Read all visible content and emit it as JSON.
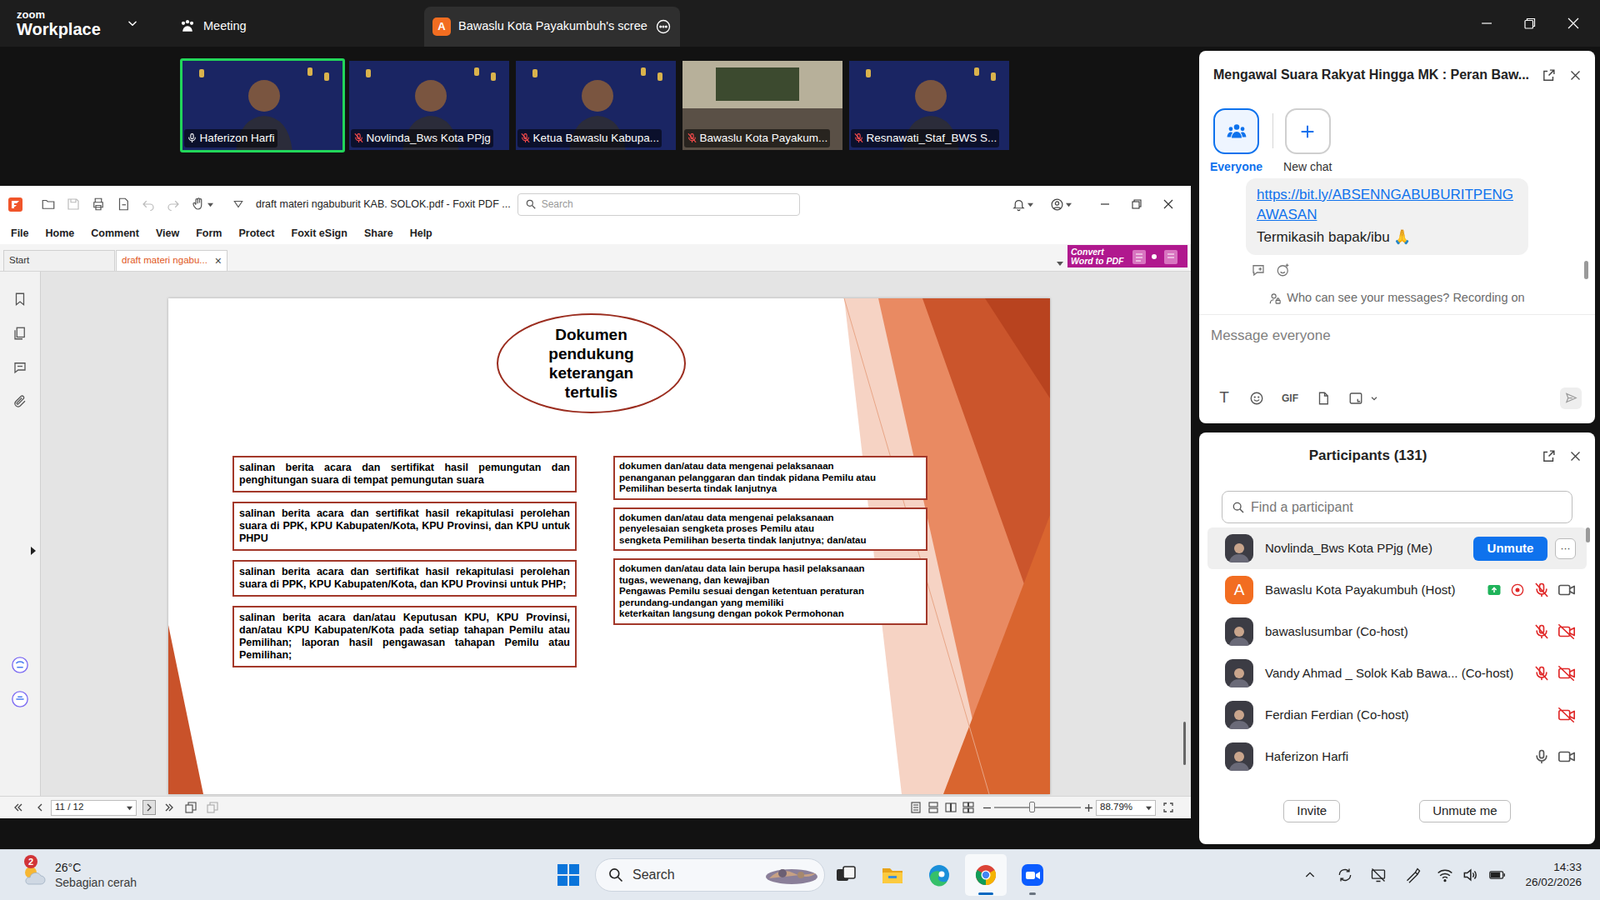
{
  "app": {
    "logo_top": "zoom",
    "logo_bottom": "Workplace"
  },
  "tabs": [
    {
      "label": "Meeting",
      "selected": false
    },
    {
      "label": "Bawaslu Kota Payakumbuh's scree",
      "avatar": "A",
      "selected": true
    }
  ],
  "videos": [
    {
      "name": "Haferizon Harfi",
      "muted": false,
      "speaking": true,
      "kind": "person"
    },
    {
      "name": "Novlinda_Bws Kota PPjg",
      "muted": true,
      "speaking": false,
      "kind": "person"
    },
    {
      "name": "Ketua Bawaslu Kabupa...",
      "muted": true,
      "speaking": false,
      "kind": "person"
    },
    {
      "name": "Bawaslu Kota Payakum...",
      "muted": true,
      "speaking": false,
      "kind": "room"
    },
    {
      "name": "Resnawati_Staf_BWS S...",
      "muted": true,
      "speaking": false,
      "kind": "person"
    }
  ],
  "pdf": {
    "title": "draft materi ngabuburit KAB. SOLOK.pdf - Foxit PDF ...",
    "search": {
      "placeholder": "Search"
    },
    "menu": [
      "File",
      "Home",
      "Comment",
      "View",
      "Form",
      "Protect",
      "Foxit eSign",
      "Share",
      "Help"
    ],
    "promo": {
      "line1": "Convert",
      "line2": "Word to PDF"
    },
    "doc_tabs": [
      {
        "label": "Start",
        "selected": false
      },
      {
        "label": "draft materi ngabu...",
        "selected": true,
        "close": "×"
      }
    ],
    "slide": {
      "title": "Dokumen pendukung keterangan tertulis",
      "left": [
        "salinan berita acara dan sertifikat hasil pemungutan dan penghitungan suara di tempat pemungutan suara",
        "salinan berita acara dan sertifikat hasil rekapitulasi perolehan suara di PPK, KPU Kabupaten/Kota, KPU Provinsi, dan KPU untuk PHPU",
        "salinan berita acara dan sertifikat hasil rekapitulasi perolehan suara di PPK, KPU Kabupaten/Kota, dan KPU Provinsi untuk PHP;",
        "salinan berita acara dan/atau Keputusan KPU, KPU Provinsi, dan/atau KPU Kabupaten/Kota pada setiap tahapan Pemilu atau Pemilihan; laporan hasil pengawasan tahapan Pemilu atau Pemilihan;"
      ],
      "right": [
        "dokumen dan/atau data mengenai pelaksanaan\npenanganan pelanggaran dan tindak pidana Pemilu atau\nPemilihan beserta tindak lanjutnya",
        "dokumen dan/atau data mengenai pelaksanaan\npenyelesaian sengketa proses Pemilu atau\nsengketa Pemilihan beserta tindak lanjutnya; dan/atau",
        "dokumen dan/atau data lain berupa hasil pelaksanaan\ntugas, wewenang, dan kewajiban\nPengawas Pemilu sesuai dengan ketentuan peraturan\nperundang-undangan yang memiliki\nketerkaitan langsung dengan pokok Permohonan"
      ]
    },
    "status": {
      "page": "11 / 12",
      "zoom": {
        "value": "88.79%",
        "level": 0.43
      }
    }
  },
  "chat": {
    "title": "Mengawal Suara Rakyat Hingga MK : Peran Baw...",
    "recipients": [
      {
        "label": "Everyone",
        "selected": true
      },
      {
        "label": "New chat",
        "selected": false
      }
    ],
    "messages": [
      {
        "link": "https://bit.ly/ABSENNGABUBURITPENGAWASAN",
        "text": "Termikasih bapak/ibu 🙏"
      }
    ],
    "notice": "Who can see your messages? Recording on",
    "input": {
      "placeholder": "Message everyone"
    },
    "toolbar": {
      "format": "T",
      "gif": "GIF"
    }
  },
  "participants": {
    "title": "Participants (131)",
    "search": {
      "placeholder": "Find a participant"
    },
    "items": [
      {
        "name": "Novlinda_Bws Kota PPjg (Me)",
        "kind": "self",
        "selected": true,
        "button": "Unmute",
        "more": "···"
      },
      {
        "name": "Bawaslu Kota Payakumbuh (Host)",
        "kind": "member",
        "selected": false,
        "avatar": "A",
        "sharing": true,
        "recording": true,
        "muted": true,
        "video_off": false
      },
      {
        "name": "bawaslusumbar (Co-host)",
        "kind": "member",
        "selected": false,
        "muted": true,
        "video_off": true
      },
      {
        "name": "Vandy Ahmad _ Solok Kab Bawa... (Co-host)",
        "kind": "member",
        "selected": false,
        "muted": true,
        "video_off": true
      },
      {
        "name": "Ferdian Ferdian (Co-host)",
        "kind": "member",
        "selected": false,
        "video_off": true
      },
      {
        "name": "Haferizon Harfi",
        "kind": "member",
        "selected": false,
        "muted": false,
        "video_off": false
      }
    ],
    "buttons": [
      "Invite",
      "Unmute me"
    ]
  },
  "taskbar": {
    "weather": {
      "temp": "26°C",
      "desc": "Sebagian cerah",
      "badge": "2"
    },
    "search": {
      "placeholder": "Search"
    },
    "apps": [
      {
        "kind": "taskview",
        "active": false,
        "focused": false
      },
      {
        "kind": "explorer",
        "active": false,
        "focused": false
      },
      {
        "kind": "edge",
        "active": false,
        "focused": false
      },
      {
        "kind": "chrome",
        "active": true,
        "focused": true
      },
      {
        "kind": "zoom",
        "active": true,
        "focused": false
      }
    ],
    "clock": {
      "time": "14:33",
      "date": "26/02/2026"
    }
  }
}
